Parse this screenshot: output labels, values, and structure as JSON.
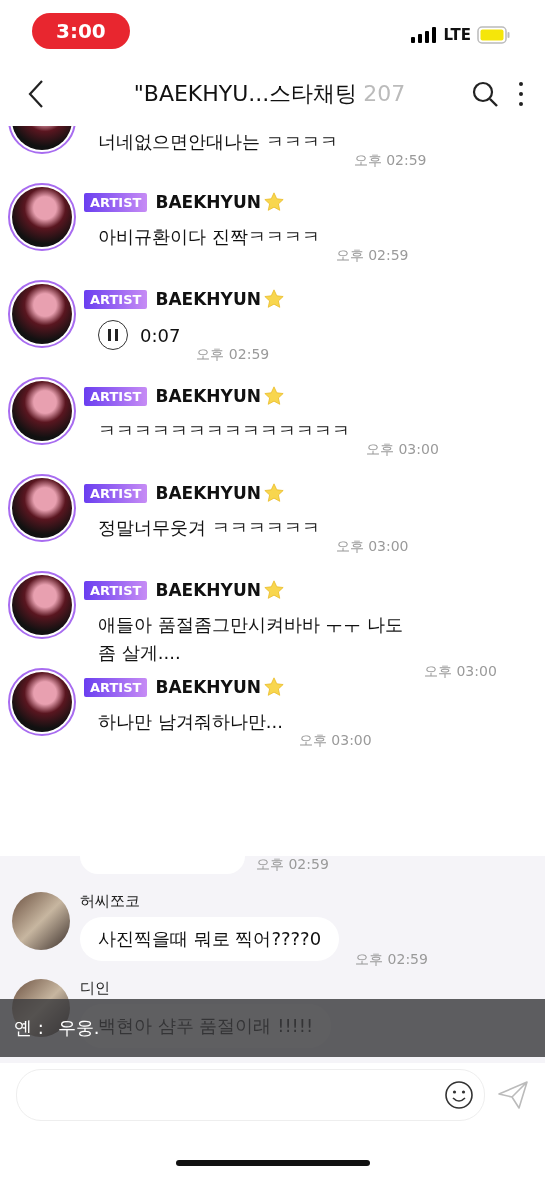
{
  "status_bar": {
    "time": "3:00",
    "network": "LTE"
  },
  "header": {
    "title": "\"BAEKHYU...스타채팅",
    "count": "207"
  },
  "cut_message": {
    "text": "너네없으면안대나는 ㅋㅋㅋㅋ",
    "time": "오후 02:59"
  },
  "artist_messages": [
    {
      "kind": "text",
      "badge": "ARTIST",
      "name": "BAEKHYUN",
      "text": "아비규환이다 진짝ㅋㅋㅋㅋ",
      "time": "오후 02:59"
    },
    {
      "kind": "voice",
      "badge": "ARTIST",
      "name": "BAEKHYUN",
      "text": "0:07",
      "time": "오후 02:59"
    },
    {
      "kind": "text",
      "badge": "ARTIST",
      "name": "BAEKHYUN",
      "text": "ㅋㅋㅋㅋㅋㅋㅋㅋㅋㅋㅋㅋㅋㅋ",
      "time": "오후 03:00"
    },
    {
      "kind": "text",
      "badge": "ARTIST",
      "name": "BAEKHYUN",
      "text": "정말너무웃겨 ㅋㅋㅋㅋㅋㅋ",
      "time": "오후 03:00"
    },
    {
      "kind": "text",
      "badge": "ARTIST",
      "name": "BAEKHYUN",
      "text": "애들아 품절좀그만시켜바바 ㅜㅜ 나도 좀 살게....",
      "time": "오후 03:00"
    },
    {
      "kind": "text",
      "badge": "ARTIST",
      "name": "BAEKHYUN",
      "text": "하나만 남겨줘하나만...",
      "time": "오후 03:00"
    }
  ],
  "divider_time": "오후 02:59",
  "fan_messages": [
    {
      "name": "허씨쪼코",
      "text": "사진찍을때 뭐로 찍어????0",
      "time": "오후 02:59"
    },
    {
      "name": "디인",
      "text": "백현아 샴푸 품절이래 !!!!!"
    }
  ],
  "caption": {
    "speaker": "옌 :",
    "text": "우웅."
  }
}
